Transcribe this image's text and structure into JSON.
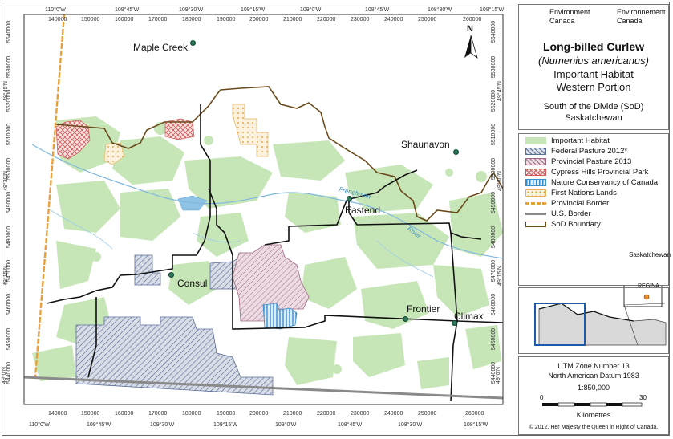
{
  "map": {
    "top_lon_ticks": [
      "110°0'W",
      "109°45'W",
      "109°30'W",
      "109°15'W",
      "109°0'W",
      "108°45'W",
      "108°30'W",
      "108°15'W"
    ],
    "bottom_lon_ticks": [
      "110°0'W",
      "109°45'W",
      "109°30'W",
      "109°15'W",
      "109°0'W",
      "108°45'W",
      "108°30'W",
      "108°15'W"
    ],
    "top_easting_ticks": [
      "140000",
      "150000",
      "160000",
      "170000",
      "180000",
      "190000",
      "200000",
      "210000",
      "220000",
      "230000",
      "240000",
      "250000",
      "260000"
    ],
    "bottom_easting_ticks": [
      "140000",
      "150000",
      "160000",
      "170000",
      "180000",
      "190000",
      "200000",
      "210000",
      "220000",
      "230000",
      "240000",
      "250000",
      "260000"
    ],
    "left_northing_ticks": [
      "5540000",
      "5530000",
      "5520000",
      "5510000",
      "5500000",
      "5490000",
      "5480000",
      "5470000",
      "5460000",
      "5450000",
      "5440000"
    ],
    "right_northing_ticks": [
      "5540000",
      "5530000",
      "5520000",
      "5510000",
      "5500000",
      "5490000",
      "5480000",
      "5470000",
      "5460000",
      "5450000",
      "5440000"
    ],
    "left_lat_ticks": [
      "49°45'N",
      "49°30'N",
      "49°15'N",
      "49°0'N"
    ],
    "right_lat_ticks": [
      "49°45'N",
      "49°30'N",
      "49°15'N",
      "49°0'N"
    ],
    "north_label": "N",
    "places": [
      {
        "name": "Maple Creek"
      },
      {
        "name": "Shaunavon"
      },
      {
        "name": "Eastend"
      },
      {
        "name": "Consul"
      },
      {
        "name": "Frontier"
      },
      {
        "name": "Climax"
      }
    ],
    "rivers": [
      "Frenchman",
      "River"
    ]
  },
  "header": {
    "agency_en_1": "Environment",
    "agency_en_2": "Canada",
    "agency_fr_1": "Environnement",
    "agency_fr_2": "Canada",
    "title": "Long-billed Curlew",
    "latin_name": "(Numenius americanus)",
    "subtitle_1": "Important Habitat",
    "subtitle_2": "Western Portion",
    "region_1": "South of the Divide (SoD)",
    "region_2": "Saskatchewan"
  },
  "legend": {
    "items": [
      {
        "label": "Important Habitat",
        "color": "#c7e6b8"
      },
      {
        "label": "Federal Pasture 2012*",
        "color": "#5a6e9a"
      },
      {
        "label": "Provincial Pasture 2013",
        "color": "#a06a86"
      },
      {
        "label": "Cypress Hills Provincial Park",
        "color": "#d25a5a"
      },
      {
        "label": "Nature Conservancy of Canada",
        "color": "#3a8fcf"
      },
      {
        "label": "First Nations Lands",
        "color": "#e3b45c"
      },
      {
        "label": "Provincial Border",
        "color": "#e8a03a"
      },
      {
        "label": "U.S. Border",
        "color": "#8a8a8a"
      },
      {
        "label": "SoD Boundary",
        "color": "#6a4a1a"
      }
    ]
  },
  "inset": {
    "province_label": "Saskatchewan",
    "city_label": "REGINA"
  },
  "projection": {
    "line_1": "UTM Zone Number 13",
    "line_2": "North American Datum 1983",
    "scale": "1:850,000",
    "bar_start": "0",
    "bar_end": "30",
    "unit": "Kilometres"
  },
  "copyright": "© 2012. Her Majesty the Queen in Right of Canada."
}
